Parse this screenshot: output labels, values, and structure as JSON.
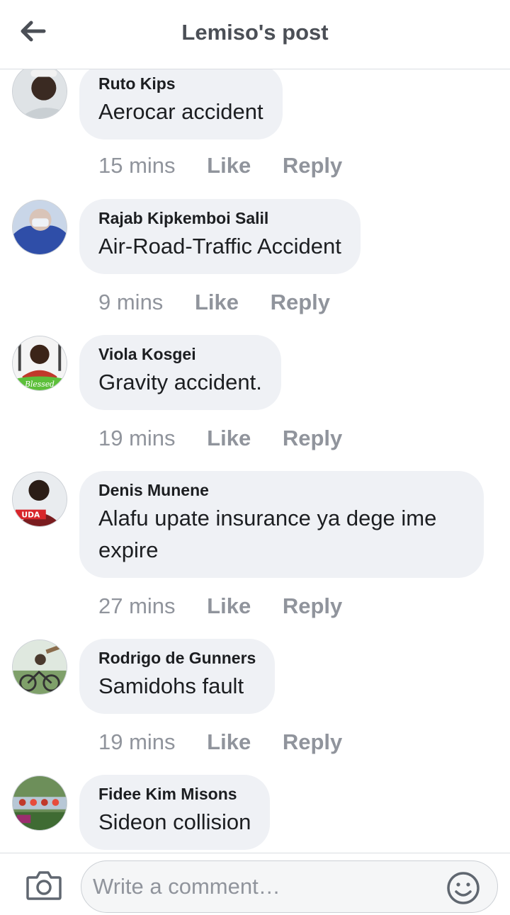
{
  "header": {
    "title": "Lemiso's post",
    "back_icon": "arrow-left-icon"
  },
  "comments": [
    {
      "author": "Ruto Kips",
      "text": "Aerocar accident",
      "time": "15 mins",
      "like": "Like",
      "reply": "Reply"
    },
    {
      "author": "Rajab Kipkemboi Salil",
      "text": "Air-Road-Traffic Accident",
      "time": "9 mins",
      "like": "Like",
      "reply": "Reply"
    },
    {
      "author": "Viola Kosgei",
      "text": "Gravity accident.",
      "time": "19 mins",
      "like": "Like",
      "reply": "Reply"
    },
    {
      "author": "Denis Munene",
      "text": "Alafu upate insurance ya dege ime expire",
      "time": "27 mins",
      "like": "Like",
      "reply": "Reply"
    },
    {
      "author": "Rodrigo de Gunners",
      "text": "Samidohs fault",
      "time": "19 mins",
      "like": "Like",
      "reply": "Reply"
    },
    {
      "author": "Fidee Kim Misons",
      "text": "Sideon collision",
      "time": "",
      "like": "",
      "reply": ""
    }
  ],
  "footer": {
    "placeholder": "Write a comment…",
    "camera_icon": "camera-icon",
    "emoji_icon": "emoji-icon"
  },
  "colors": {
    "bubble": "#eff1f5",
    "meta_text": "#90949c",
    "title_text": "#4b4f56",
    "avatar_3_accent": "#5cbf3a",
    "avatar_4_badge": "#d8262b"
  }
}
